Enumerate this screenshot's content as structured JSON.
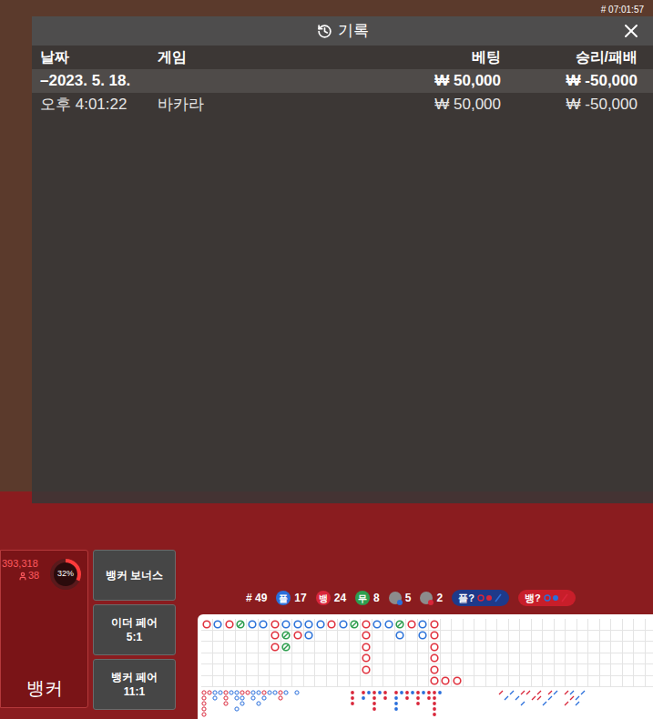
{
  "timestamp": "# 07:01:57",
  "history": {
    "title": "기록",
    "columns": [
      "날짜",
      "게임",
      "베팅",
      "승리/패배"
    ],
    "rows": [
      {
        "date": "–2023. 5. 18.",
        "game": "",
        "bet": "₩ 50,000",
        "result": "₩ -50,000",
        "kind": "group"
      },
      {
        "date": "오후 4:01:22",
        "game": "바카라",
        "bet": "₩ 50,000",
        "result": "₩ -50,000",
        "kind": "entry"
      }
    ]
  },
  "banker_spot": {
    "amount": "393,318",
    "players": "38",
    "percent": "32%",
    "level": 0.32,
    "label": "뱅커"
  },
  "side_bets": [
    {
      "label": "뱅커 보너스",
      "odds": ""
    },
    {
      "label": "이더 페어",
      "odds": "5:1"
    },
    {
      "label": "뱅커 페어",
      "odds": "11:1"
    }
  ],
  "stats": {
    "round": "# 49",
    "items": [
      {
        "kind": "badge",
        "badge": "플",
        "count": "17",
        "color": "#2a6fdb"
      },
      {
        "kind": "badge",
        "badge": "뱅",
        "count": "24",
        "color": "#d9263a"
      },
      {
        "kind": "badge",
        "badge": "무",
        "count": "8",
        "color": "#2e9e4f"
      },
      {
        "kind": "dot",
        "badge": "",
        "count": "5",
        "color": "#2a6fdb"
      },
      {
        "kind": "dot",
        "badge": "",
        "count": "2",
        "color": "#d9263a"
      }
    ],
    "predict": [
      {
        "label": "플?",
        "color": "#1e3a8a",
        "marks": [
          "#d9263a",
          "#d9263a",
          "#2a6fdb"
        ]
      },
      {
        "label": "뱅?",
        "color": "#c81e2a",
        "marks": [
          "#2a6fdb",
          "#2a6fdb",
          "#d9263a"
        ]
      }
    ]
  },
  "board": {
    "colors": {
      "B": "#e0323e",
      "P": "#2d73d9",
      "T": "#2e9e4f",
      "r": "#d9263a",
      "b": "#2a6fdb"
    },
    "big_road": [
      "BPBTPPBPPPPBPTBPPTBPB...................",
      "......BTBP....B..P.PB...................",
      "......BT......B.....B...................",
      "..............B.....B...................",
      "..............B.....B...................",
      "....................BBB................."
    ],
    "small_roads": [
      {
        "kind": "ring",
        "rows": [
          "rrbbrbbrrbbrbbrb.b..",
          "r.b.r.bb.b.b..r.....",
          "r...r..b..b.........",
          "r.....b.............",
          "r..................."
        ]
      },
      {
        "kind": "dot",
        "rows": [
          "r.rbrbr.rbrbrbrrb...",
          "r.b.r.r.b.r.r.rr....",
          "r...r...b...r..r....",
          "....r...b......r....",
          "...............r...."
        ]
      },
      {
        "kind": "slash",
        "rows": [
          "r.b.rr.r.rb.rb.b....",
          ".b.b..rr.b...rb.....",
          "....b...b...r.b.....",
          "....................",
          "...................."
        ]
      }
    ]
  }
}
